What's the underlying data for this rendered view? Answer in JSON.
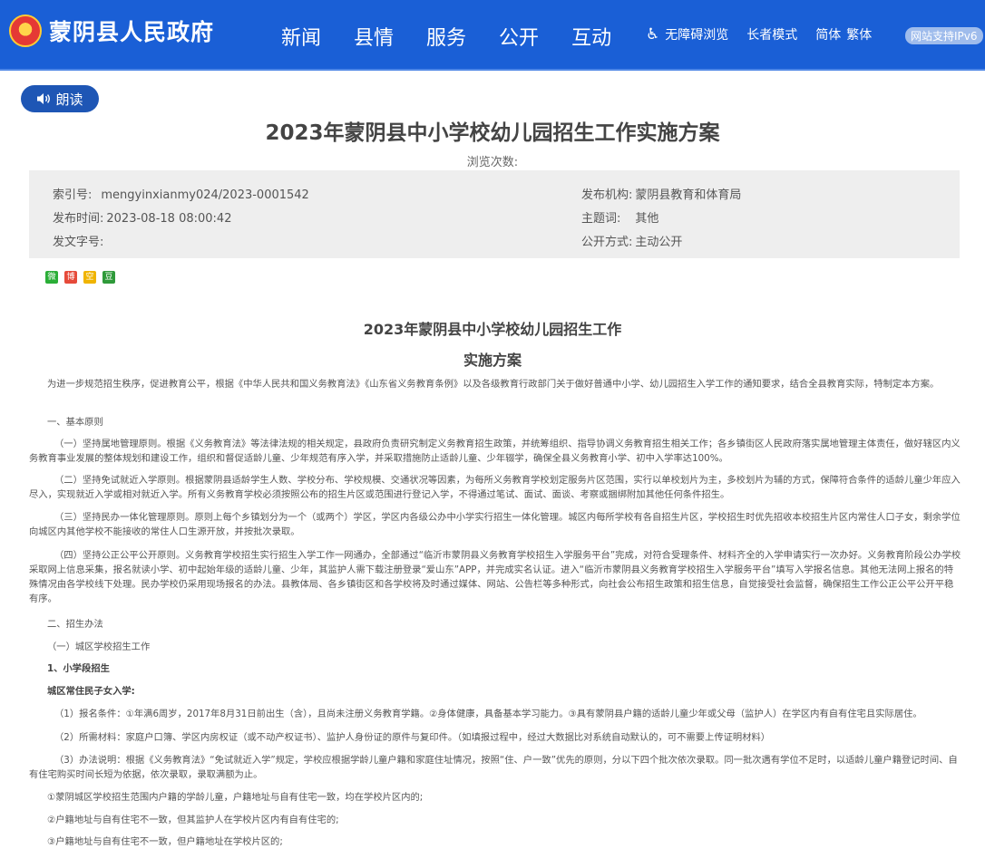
{
  "header": {
    "site_name": "蒙阴县人民政府",
    "nav": [
      "新闻",
      "县情",
      "服务",
      "公开",
      "互动"
    ],
    "accessibility": "无障碍浏览",
    "elder_mode": "长者模式",
    "simplified": "简体",
    "traditional": "繁体",
    "ipv6": "网站支持IPv6"
  },
  "read_button": "朗读",
  "title": "2023年蒙阴县中小学校幼儿园招生工作实施方案",
  "views_label": "浏览次数:",
  "meta": {
    "index_label": "索引号:",
    "index_value": "mengyinxianmy024/2023-0001542",
    "publisher_label": "发布机构:",
    "publisher_value": "蒙阴县教育和体育局",
    "date_label": "发布时间:",
    "date_value": "2023-08-18 08:00:42",
    "topic_label": "主题词:",
    "topic_value": "其他",
    "doc_no_label": "发文字号:",
    "doc_no_value": "",
    "open_label": "公开方式:",
    "open_value": "主动公开"
  },
  "share_icons": [
    {
      "name": "wechat-icon",
      "glyph": "微",
      "color": "#2aae37"
    },
    {
      "name": "weibo-icon",
      "glyph": "博",
      "color": "#e64a3a"
    },
    {
      "name": "qzone-icon",
      "glyph": "空",
      "color": "#f0b400"
    },
    {
      "name": "douban-icon",
      "glyph": "豆",
      "color": "#2f9a3a"
    }
  ],
  "doc": {
    "title_line1": "2023年蒙阴县中小学校幼儿园招生工作",
    "title_line2": "实施方案",
    "intro": "为进一步规范招生秩序，促进教育公平，根据《中华人民共和国义务教育法》《山东省义务教育条例》以及各级教育行政部门关于做好普通中小学、幼儿园招生入学工作的通知要求，结合全县教育实际，特制定本方案。",
    "s1": "一、基本原则",
    "p1": "（一）坚持属地管理原则。根据《义务教育法》等法律法规的相关规定，县政府负责研究制定义务教育招生政策，并统筹组织、指导协调义务教育招生相关工作；各乡镇街区人民政府落实属地管理主体责任，做好辖区内义务教育事业发展的整体规划和建设工作，组织和督促适龄儿童、少年规范有序入学，并采取措施防止适龄儿童、少年辍学，确保全县义务教育小学、初中入学率达100%。",
    "p2": "（二）坚持免试就近入学原则。根据蒙阴县适龄学生人数、学校分布、学校规模、交通状况等因素，为每所义务教育学校划定服务片区范围，实行以单校划片为主，多校划片为辅的方式，保障符合条件的适龄儿童少年应入尽入，实现就近入学或相对就近入学。所有义务教育学校必须按照公布的招生片区或范围进行登记入学，不得通过笔试、面试、面谈、考察或捆绑附加其他任何条件招生。",
    "p3": "（三）坚持民办一体化管理原则。原则上每个乡镇划分为一个（或两个）学区，学区内各级公办中小学实行招生一体化管理。城区内每所学校有各自招生片区，学校招生时优先招收本校招生片区内常住人口子女，剩余学位向城区内其他学校不能接收的常住人口生源开放，并按批次录取。",
    "p4": "（四）坚持公正公平公开原则。义务教育学校招生实行招生入学工作一网通办，全部通过“临沂市蒙阴县义务教育学校招生入学服务平台”完成，对符合受理条件、材料齐全的入学申请实行一次办好。义务教育阶段公办学校采取网上信息采集，报名就读小学、初中起始年级的适龄儿童、少年，其监护人需下载注册登录“爱山东”APP，并完成实名认证。进入“临沂市蒙阴县义务教育学校招生入学服务平台”填写入学报名信息。其他无法网上报名的特殊情况由各学校线下处理。民办学校仍采用现场报名的办法。县教体局、各乡镇街区和各学校将及时通过媒体、网站、公告栏等多种形式，向社会公布招生政策和招生信息，自觉接受社会监督，确保招生工作公正公平公开平稳有序。",
    "s2": "二、招生办法",
    "s2_1": "（一）城区学校招生工作",
    "s2_1_1": "1、小学段招生",
    "s2_1_1_a": "城区常住民子女入学:",
    "c1": "（1）报名条件：①年满6周岁，2017年8月31日前出生（含），且尚未注册义务教育学籍。②身体健康，具备基本学习能力。③具有蒙阴县户籍的适龄儿童少年或父母（监护人）在学区内有自有住宅且实际居住。",
    "c2": "（2）所需材料：家庭户口簿、学区内房权证（或不动产权证书）、监护人身份证的原件与复印件。（如填报过程中，经过大数据比对系统自动默认的，可不需要上传证明材料）",
    "c3": "（3）办法说明：根据《义务教育法》“免试就近入学”规定，学校应根据学龄儿童户籍和家庭住址情况，按照“住、户一致”优先的原则，分以下四个批次依次录取。同一批次遇有学位不足时，以适龄儿童户籍登记时间、自有住宅购买时间长短为依据，依次录取，录取满额为止。",
    "r1": "①蒙阴城区学校招生范围内户籍的学龄儿童，户籍地址与自有住宅一致，均在学校片区内的;",
    "r2": "②户籍地址与自有住宅不一致，但其监护人在学校片区内有自有住宅的;",
    "r3": "③户籍地址与自有住宅不一致，但户籍地址在学校片区的;"
  }
}
